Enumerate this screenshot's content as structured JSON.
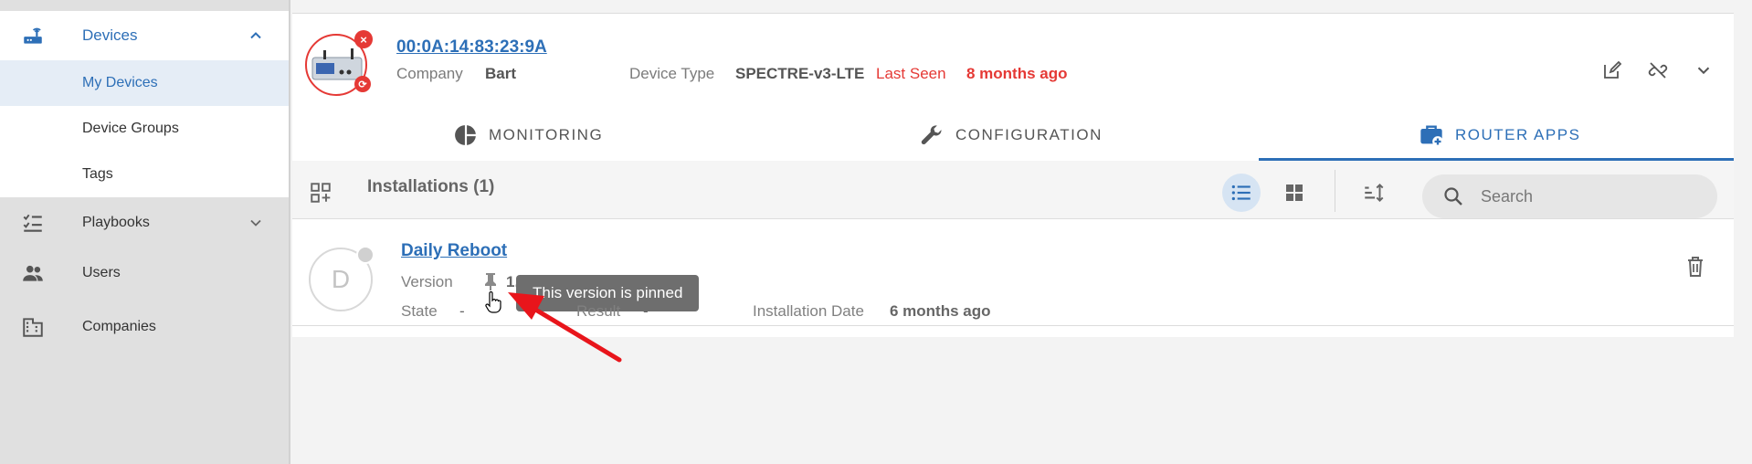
{
  "sidebar": {
    "devices": {
      "label": "Devices",
      "icon": "router-icon"
    },
    "sub_items": [
      {
        "label": "My Devices",
        "active": true
      },
      {
        "label": "Device Groups",
        "active": false
      },
      {
        "label": "Tags",
        "active": false
      }
    ],
    "playbooks": {
      "label": "Playbooks",
      "icon": "checklist-icon"
    },
    "users": {
      "label": "Users",
      "icon": "people-icon"
    },
    "companies": {
      "label": "Companies",
      "icon": "building-icon"
    }
  },
  "device": {
    "mac": "00:0A:14:83:23:9A",
    "company_label": "Company",
    "company_value": "Bart",
    "device_type_label": "Device Type",
    "device_type_value": "SPECTRE-v3-LTE",
    "last_seen_label": "Last Seen",
    "last_seen_value": "8 months ago"
  },
  "tabs": [
    {
      "label": "MONITORING",
      "icon": "pie-chart-icon"
    },
    {
      "label": "CONFIGURATION",
      "icon": "wrench-icon"
    },
    {
      "label": "ROUTER APPS",
      "icon": "briefcase-plus-icon",
      "active": true
    }
  ],
  "toolbar": {
    "title": "Installations (1)",
    "search_placeholder": "Search"
  },
  "installation": {
    "avatar_letter": "D",
    "name": "Daily Reboot",
    "version_label": "Version",
    "version_value": "1.1",
    "state_label": "State",
    "state_value": "-",
    "result_label": "Result",
    "result_value": "-",
    "date_label": "Installation Date",
    "date_value": "6 months ago",
    "tooltip": "This version is pinned"
  },
  "colors": {
    "accent": "#2d6fb7",
    "error": "#e53935",
    "annotation_arrow": "#e8151b"
  }
}
